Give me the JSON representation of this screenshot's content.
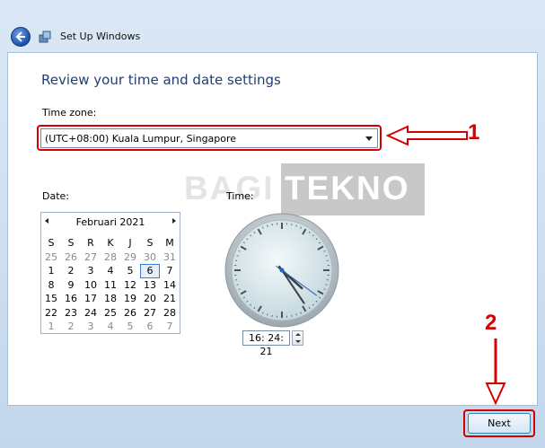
{
  "window": {
    "title": "Set Up Windows"
  },
  "page": {
    "heading": "Review your time and date settings"
  },
  "timezone": {
    "label": "Time zone:",
    "value": "(UTC+08:00) Kuala Lumpur, Singapore"
  },
  "date": {
    "label": "Date:",
    "month_title": "Februari 2021",
    "weekday_headers": [
      "S",
      "S",
      "R",
      "K",
      "J",
      "S",
      "M"
    ],
    "weeks": [
      [
        "25",
        "26",
        "27",
        "28",
        "29",
        "30",
        "31"
      ],
      [
        "1",
        "2",
        "3",
        "4",
        "5",
        "6",
        "7"
      ],
      [
        "8",
        "9",
        "10",
        "11",
        "12",
        "13",
        "14"
      ],
      [
        "15",
        "16",
        "17",
        "18",
        "19",
        "20",
        "21"
      ],
      [
        "22",
        "23",
        "24",
        "25",
        "26",
        "27",
        "28"
      ],
      [
        "1",
        "2",
        "3",
        "4",
        "5",
        "6",
        "7"
      ]
    ],
    "selected_day": "6"
  },
  "time": {
    "label": "Time:",
    "value": "16: 24: 21"
  },
  "watermark": {
    "part1": "BAGI",
    "part2": "TEKNO"
  },
  "annotations": {
    "marker1": "1",
    "marker2": "2",
    "color": "#d60000"
  },
  "buttons": {
    "next_label": "Next"
  },
  "icons": {
    "back": "back-arrow-icon",
    "setup": "setup-windows-icon"
  }
}
